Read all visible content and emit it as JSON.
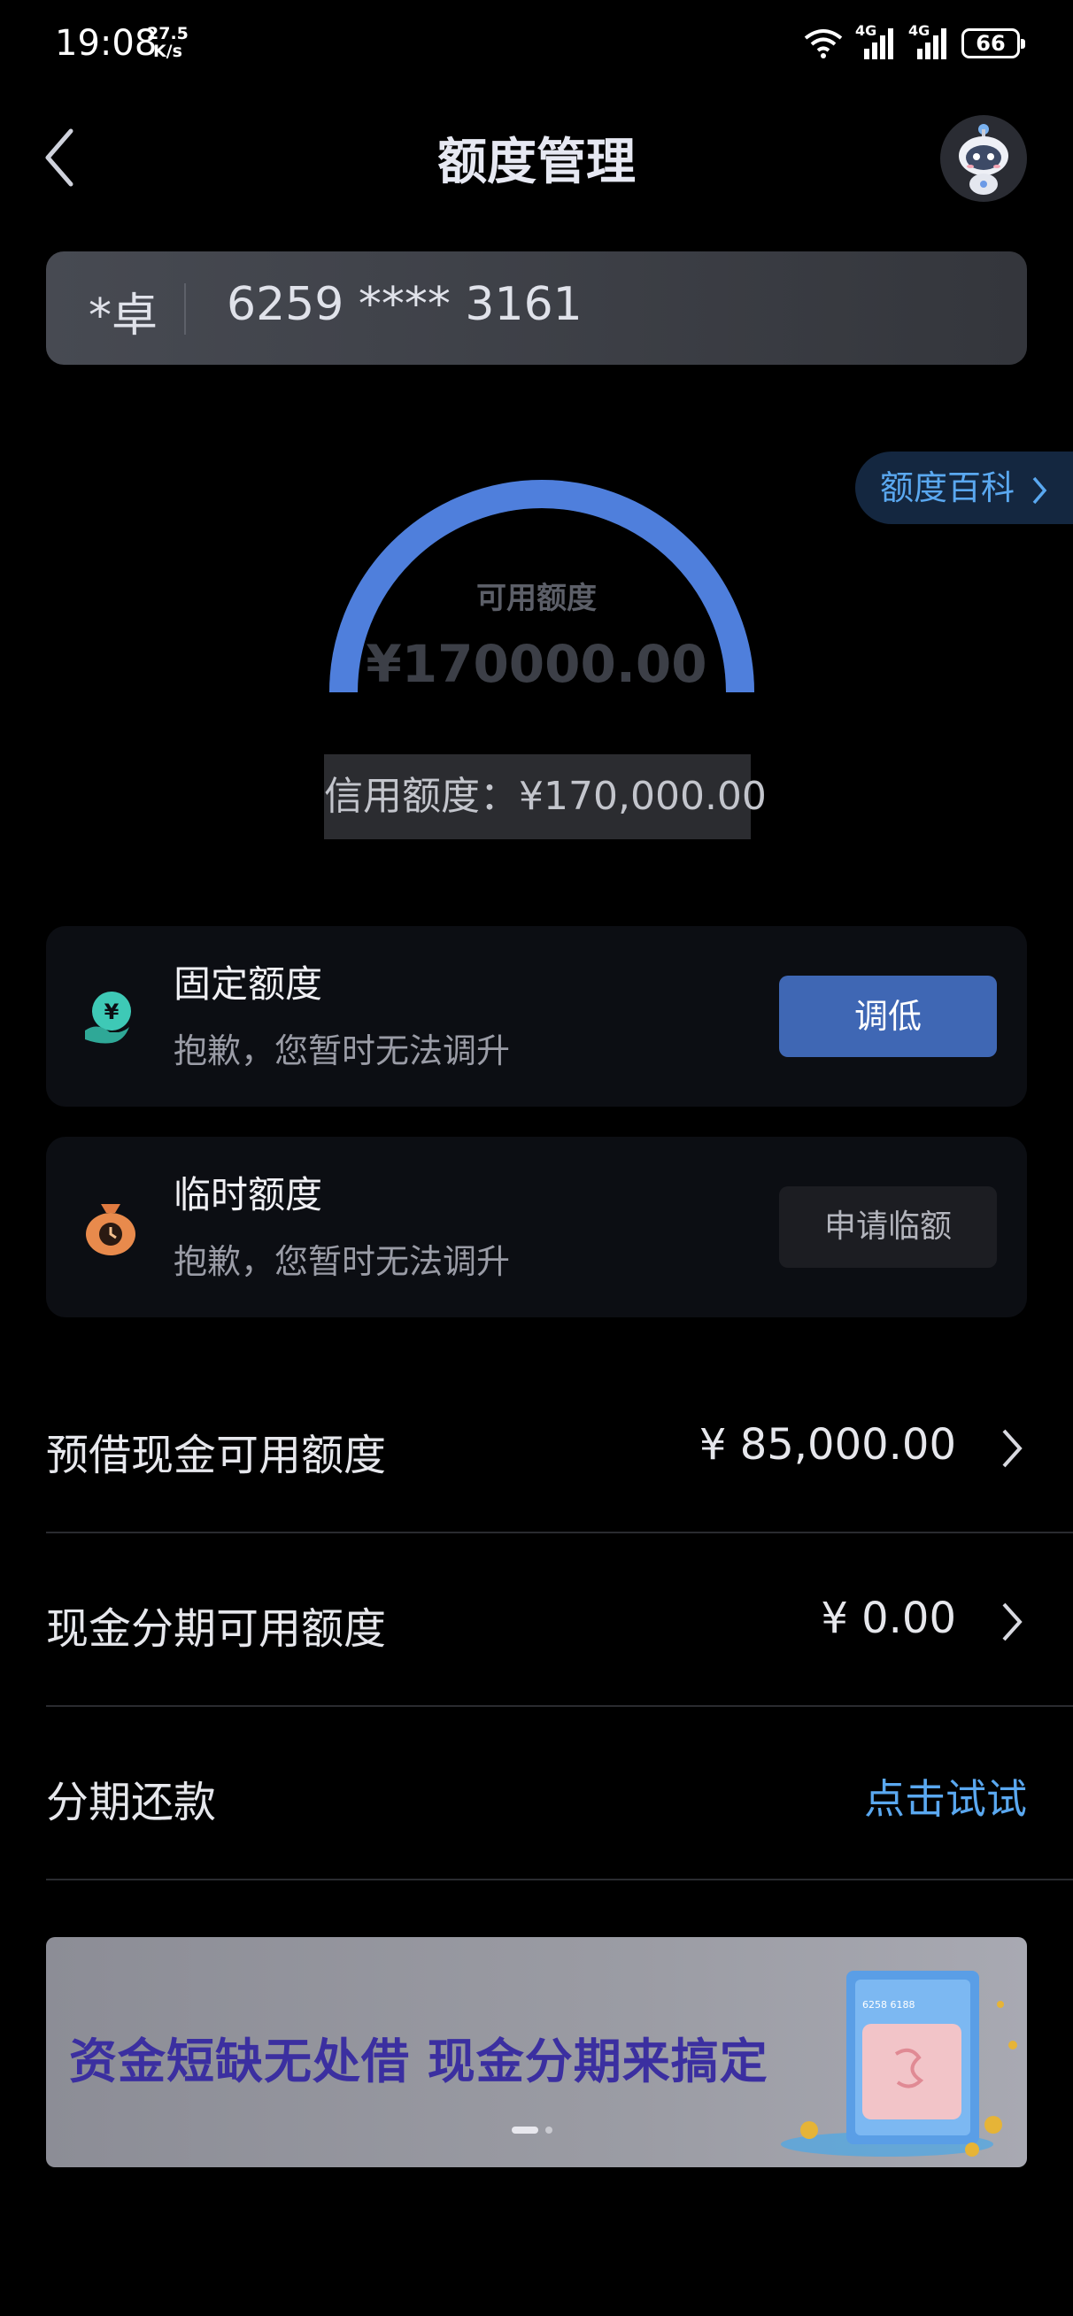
{
  "status_bar": {
    "time": "19:08",
    "speed_value": "27.5",
    "speed_unit": "K/s",
    "network_label_1": "4G",
    "network_label_2": "4G",
    "battery": "66"
  },
  "header": {
    "title": "额度管理",
    "back_icon": "chevron-left-icon",
    "avatar_icon": "robot-mascot-icon"
  },
  "card": {
    "owner": "*卓",
    "number": "6259 **** 3161"
  },
  "encyclopedia_link": "额度百科",
  "gauge": {
    "label": "可用额度",
    "amount": "¥170000.00",
    "progress_fraction": 1.0,
    "color": "#4f7fdc"
  },
  "credit_limit_text": "信用额度：¥170,000.00",
  "fixed_quota": {
    "title": "固定额度",
    "subtitle": "抱歉，您暂时无法调升",
    "button": "调低",
    "icon": "yuan-hand-icon"
  },
  "temp_quota": {
    "title": "临时额度",
    "subtitle": "抱歉，您暂时无法调升",
    "button": "申请临额",
    "icon": "money-bag-clock-icon"
  },
  "rows": [
    {
      "label": "预借现金可用额度",
      "value": "¥ 85,000.00"
    },
    {
      "label": "现金分期可用额度",
      "value": "¥ 0.00"
    },
    {
      "label": "分期还款",
      "action": "点击试试"
    }
  ],
  "banner": {
    "text": "资金短缺无处借  现金分期来搞定",
    "card_number_text": "6258  6188",
    "active_slide": 1,
    "slide_count": 2
  },
  "colors": {
    "accent_blue": "#5aa8f0",
    "button_blue": "#3f67b4"
  }
}
